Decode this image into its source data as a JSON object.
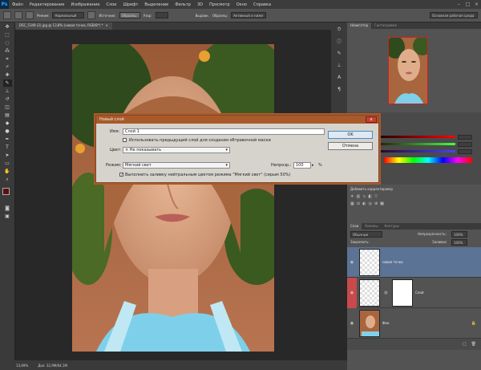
{
  "app": {
    "logo": "Ps"
  },
  "menu": [
    "Файл",
    "Редактирование",
    "Изображение",
    "Слои",
    "Шрифт",
    "Выделение",
    "Фильтр",
    "3D",
    "Просмотр",
    "Окно",
    "Справка"
  ],
  "options": {
    "mode_label": "Режим:",
    "mode_value": "Нормальный",
    "source_label": "Источник:",
    "source_value": "Образец",
    "pattern_label": "Узор:",
    "aligned_label": "Выравн.",
    "sample_label": "Образец:",
    "sample_value": "Активный и ниже",
    "workspace": "Основная рабочая среда"
  },
  "document": {
    "tab": "DSC_5349 (2).jpg @ 13,8% (новая точка, RGB/8*) *",
    "close": "×"
  },
  "status": {
    "zoom": "13,69%",
    "doc": "Док: 32,9M/64,1M"
  },
  "navigator": {
    "tab1": "Навигатор",
    "tab2": "Гистограмма"
  },
  "adjustments": {
    "title": "Добавить корректировку"
  },
  "layers_panel": {
    "tabs": [
      "Слои",
      "Каналы",
      "Контуры"
    ],
    "blend": "Обычные",
    "opacity_label": "Непрозрачность:",
    "opacity_value": "100%",
    "lock_label": "Закрепить:",
    "fill_label": "Заливка:",
    "fill_value": "100%",
    "layers": [
      {
        "name": "новая точка"
      },
      {
        "name": "Слой"
      },
      {
        "name": "Фон"
      }
    ]
  },
  "dialog": {
    "title": "Новый слой",
    "close": "x",
    "name_label": "Имя:",
    "name_value": "Слой 1",
    "clip_label": "Использовать предыдущий слой для создания обтравочной маски",
    "color_label": "Цвет:",
    "color_value": "Не показывать",
    "mode_label": "Режим:",
    "mode_value": "Мягкий свет",
    "opacity_label": "Непрозр.:",
    "opacity_value": "100",
    "percent": "%",
    "fill_label": "Выполнить заливку нейтральным цветом режима \"Мягкий свет\" (серым 50%)",
    "ok": "OK",
    "cancel": "Отмена"
  },
  "colors": {
    "accent": "#5b7394",
    "dialog_border": "#b0582a",
    "foreground": "#5a1010"
  }
}
